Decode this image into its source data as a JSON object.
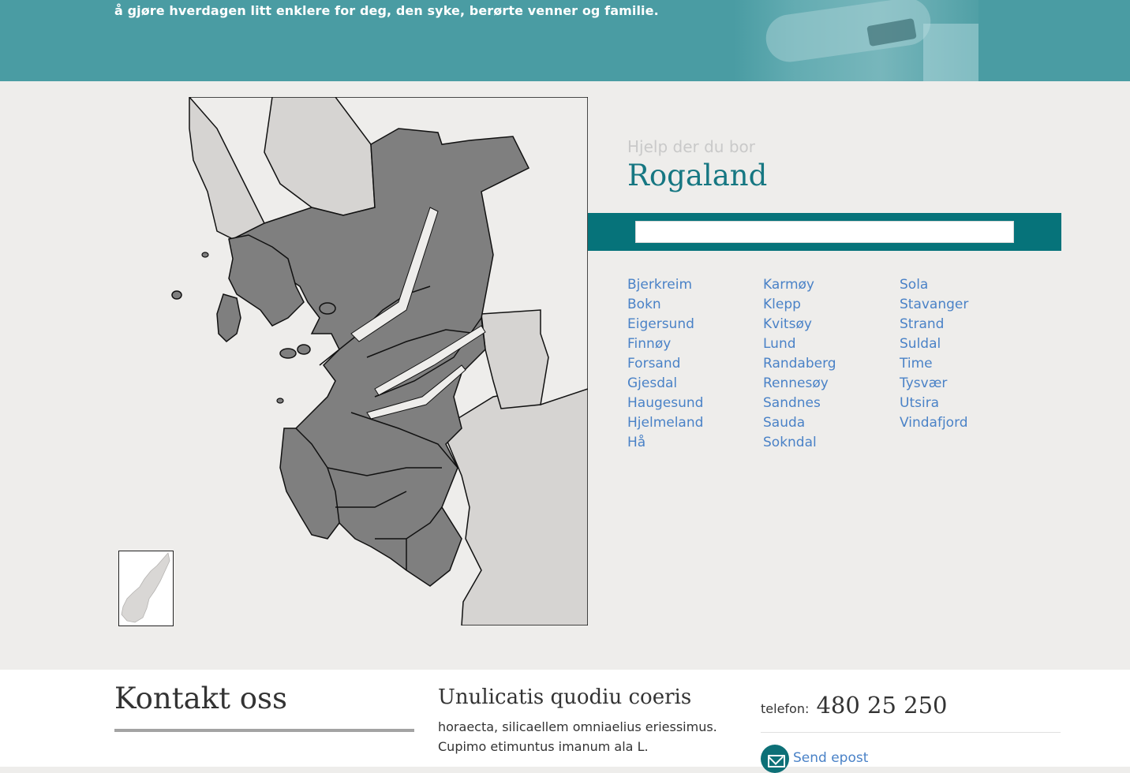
{
  "hero": {
    "tagline": "å gjøre hverdagen litt enklere for deg, den syke, berørte venner og familie."
  },
  "region": {
    "subtitle": "Hjelp der du bor",
    "title": "Rogaland"
  },
  "search": {
    "value": "",
    "placeholder": ""
  },
  "municipalities": {
    "col1": [
      "Bjerkreim",
      "Bokn",
      "Eigersund",
      "Finnøy",
      "Forsand",
      "Gjesdal",
      "Haugesund",
      "Hjelmeland",
      "Hå"
    ],
    "col2": [
      "Karmøy",
      "Klepp",
      "Kvitsøy",
      "Lund",
      "Randaberg",
      "Rennesøy",
      "Sandnes",
      "Sauda",
      "Sokndal"
    ],
    "col3": [
      "Sola",
      "Stavanger",
      "Strand",
      "Suldal",
      "Time",
      "Tysvær",
      "Utsira",
      "Vindafjord"
    ]
  },
  "footer": {
    "contact_title": "Kontakt oss",
    "col_title": "Unulicatis quodiu coeris",
    "col_body": "horaecta, silicaellem omniaelius eriessimus. Cupimo etimuntus imanum ala L.",
    "phone_label": "telefon:",
    "phone_number": "480 25 250",
    "mail_label": "Send epost"
  },
  "colors": {
    "hero_bg": "#4a9ca3",
    "accent": "#06737a",
    "link": "#4a82c7",
    "map_region": "#7f7f7f",
    "map_neighbor": "#d6d4d2"
  }
}
